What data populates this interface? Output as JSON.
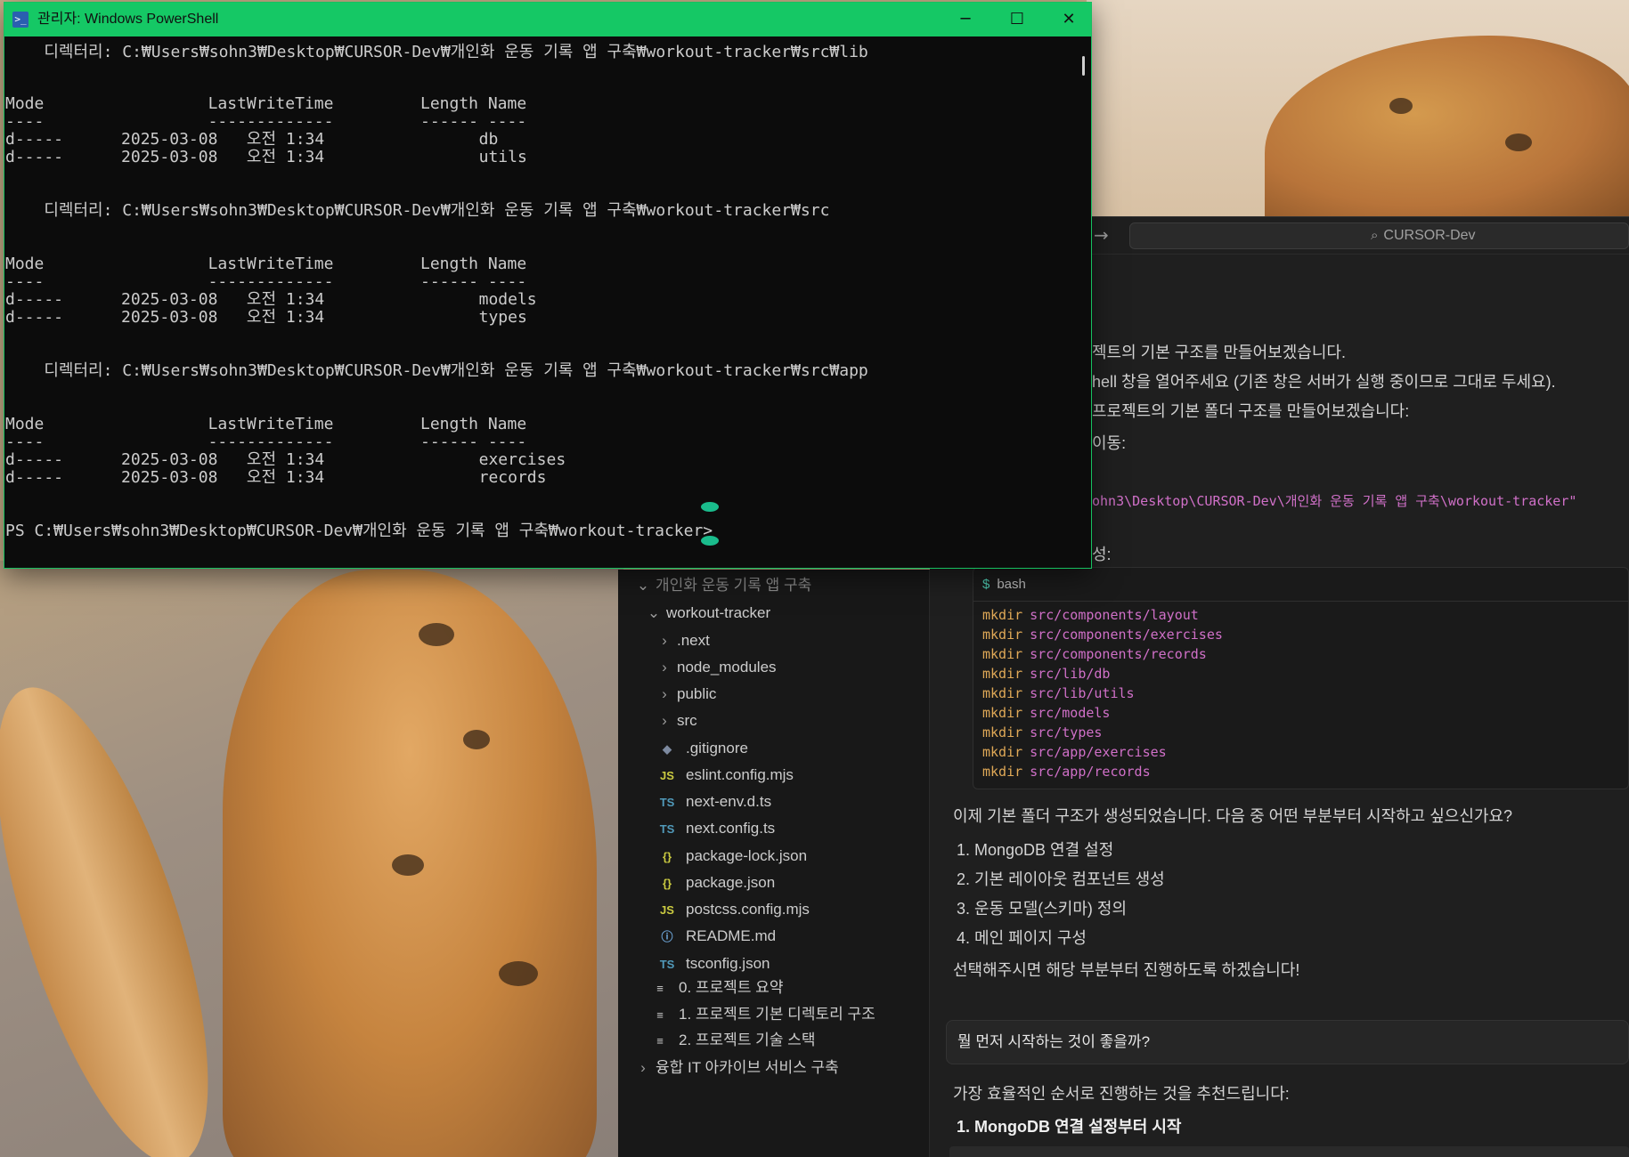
{
  "powershell": {
    "title": "관리자: Windows PowerShell",
    "lines": [
      {
        "text": "    디렉터리: C:₩Users₩sohn3₩Desktop₩CURSOR-Dev₩개인화 운동 기록 앱 구축₩workout-tracker₩src₩lib"
      },
      {
        "text": "Mode                 LastWriteTime         Length Name"
      },
      {
        "text": "----                 -------------         ------ ----"
      },
      {
        "text": "d-----      2025-03-08   오전 1:34                db"
      },
      {
        "text": "d-----      2025-03-08   오전 1:34                utils"
      },
      {
        "text": "    디렉터리: C:₩Users₩sohn3₩Desktop₩CURSOR-Dev₩개인화 운동 기록 앱 구축₩workout-tracker₩src"
      },
      {
        "text": "Mode                 LastWriteTime         Length Name"
      },
      {
        "text": "----                 -------------         ------ ----"
      },
      {
        "text": "d-----      2025-03-08   오전 1:34                models"
      },
      {
        "text": "d-----      2025-03-08   오전 1:34                types"
      },
      {
        "text": "    디렉터리: C:₩Users₩sohn3₩Desktop₩CURSOR-Dev₩개인화 운동 기록 앱 구축₩workout-tracker₩src₩app"
      },
      {
        "text": "Mode                 LastWriteTime         Length Name"
      },
      {
        "text": "----                 -------------         ------ ----"
      },
      {
        "text": "d-----      2025-03-08   오전 1:34                exercises"
      },
      {
        "text": "d-----      2025-03-08   오전 1:34                records"
      },
      {
        "text": "PS C:₩Users₩sohn3₩Desktop₩CURSOR-Dev₩개인화 운동 기록 앱 구축₩workout-tracker>"
      }
    ]
  },
  "cursor": {
    "search_label": "CURSOR-Dev",
    "nav_arrow": "→"
  },
  "explorer": {
    "items": [
      {
        "label": "개인화 운동 기록 앱 구축",
        "kind": "folder-open",
        "depth": 0
      },
      {
        "label": "workout-tracker",
        "kind": "folder-open",
        "depth": 1
      },
      {
        "label": ".next",
        "kind": "folder",
        "depth": 2
      },
      {
        "label": "node_modules",
        "kind": "folder",
        "depth": 2
      },
      {
        "label": "public",
        "kind": "folder",
        "depth": 2
      },
      {
        "label": "src",
        "kind": "folder",
        "depth": 2
      },
      {
        "label": ".gitignore",
        "kind": "git",
        "depth": 2
      },
      {
        "label": "eslint.config.mjs",
        "kind": "js",
        "depth": 2
      },
      {
        "label": "next-env.d.ts",
        "kind": "ts",
        "depth": 2
      },
      {
        "label": "next.config.ts",
        "kind": "ts",
        "depth": 2
      },
      {
        "label": "package-lock.json",
        "kind": "json",
        "depth": 2
      },
      {
        "label": "package.json",
        "kind": "json",
        "depth": 2
      },
      {
        "label": "postcss.config.mjs",
        "kind": "js",
        "depth": 2
      },
      {
        "label": "README.md",
        "kind": "info",
        "depth": 2
      },
      {
        "label": "tsconfig.json",
        "kind": "ts",
        "depth": 2
      },
      {
        "label": "0. 프로젝트 요약",
        "kind": "doc",
        "depth": 0
      },
      {
        "label": "1. 프로젝트 기본 디렉토리 구조",
        "kind": "doc",
        "depth": 0
      },
      {
        "label": "2. 프로젝트 기술 스택",
        "kind": "doc",
        "depth": 0
      },
      {
        "label": "융합 IT 아카이브 서비스 구축",
        "kind": "folder",
        "depth": -1
      }
    ],
    "icons": {
      "js": "JS",
      "ts": "TS",
      "json": "{}",
      "info": "ⓘ",
      "git": "◆",
      "doc": "≡",
      "folder": "›",
      "folder-open": "⌄"
    }
  },
  "chat": {
    "partial_lines": [
      "젝트의 기본 구조를 만들어보겠습니다.",
      "hell 창을 열어주세요 (기존 창은 서버가 실행 중이므로 그대로 두세요).",
      "프로젝트의 기본 폴더 구조를 만들어보겠습니다:",
      "이동:"
    ],
    "path_line": "ohn3\\Desktop\\CURSOR-Dev\\개인화 운동 기록 앱 구축\\workout-tracker\"",
    "partial_create": "성:",
    "code": {
      "lang": "bash",
      "lines": [
        {
          "cmd": "mkdir",
          "path": "src/components/layout"
        },
        {
          "cmd": "mkdir",
          "path": "src/components/exercises"
        },
        {
          "cmd": "mkdir",
          "path": "src/components/records"
        },
        {
          "cmd": "mkdir",
          "path": "src/lib/db"
        },
        {
          "cmd": "mkdir",
          "path": "src/lib/utils"
        },
        {
          "cmd": "mkdir",
          "path": "src/models"
        },
        {
          "cmd": "mkdir",
          "path": "src/types"
        },
        {
          "cmd": "mkdir",
          "path": "src/app/exercises"
        },
        {
          "cmd": "mkdir",
          "path": "src/app/records"
        }
      ]
    },
    "after_text": "이제 기본 폴더 구조가 생성되었습니다. 다음 중 어떤 부분부터 시작하고 싶으신가요?",
    "options": [
      "1. MongoDB 연결 설정",
      "2. 기본 레이아웃 컴포넌트 생성",
      "3. 운동 모델(스키마) 정의",
      "4. 메인 페이지 구성"
    ],
    "closing": "선택해주시면 해당 부분부터 진행하도록 하겠습니다!",
    "user_question": "뭘 먼저 시작하는 것이 좋을까?",
    "reply_intro": "가장 효율적인 순서로 진행하는 것을 추천드립니다:",
    "reply_step1": "1. MongoDB 연결 설정부터 시작"
  }
}
